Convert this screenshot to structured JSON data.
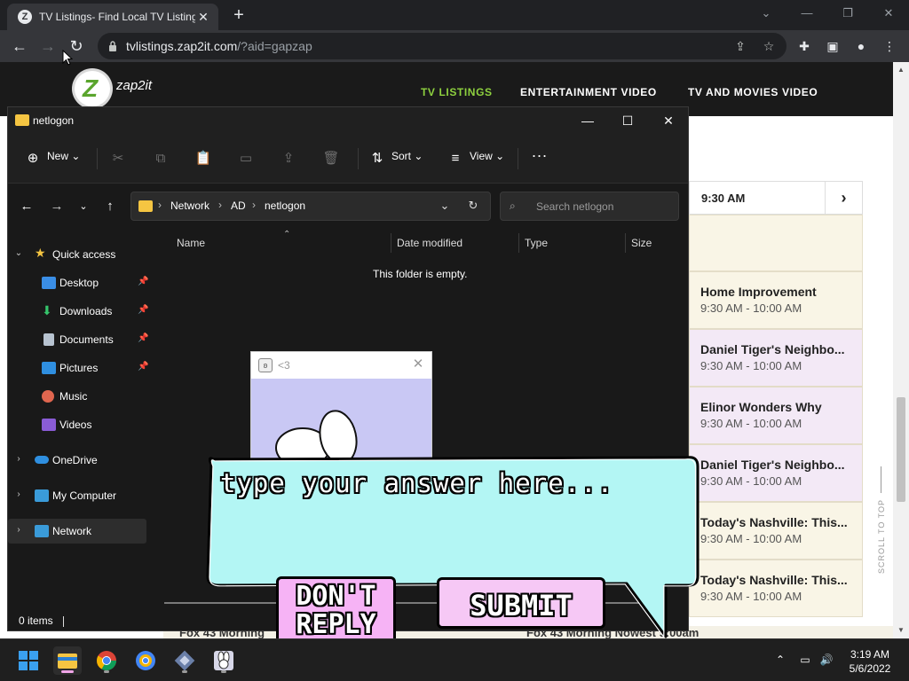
{
  "browser": {
    "tab_title": "TV Listings- Find Local TV Listings",
    "tab_favicon_letter": "Z",
    "url_host": "tvlistings.zap2it.com",
    "url_path": "/?aid=gapzap"
  },
  "site": {
    "logo_word": "zap2it",
    "logo_letter": "Z",
    "nav": [
      "TV LISTINGS",
      "ENTERTAINMENT VIDEO",
      "TV AND MOVIES VIDEO"
    ],
    "time_slot": "9:30 AM",
    "shows": [
      {
        "title": "Home Improvement",
        "time": "9:30 AM - 10:00 AM",
        "bg": "#f9f5e6"
      },
      {
        "title": "Daniel Tiger's Neighbo...",
        "time": "9:30 AM - 10:00 AM",
        "bg": "#f3e9f6"
      },
      {
        "title": "Elinor Wonders Why",
        "time": "9:30 AM - 10:00 AM",
        "bg": "#f3e9f6"
      },
      {
        "title": "Daniel Tiger's Neighbo...",
        "time": "9:30 AM - 10:00 AM",
        "bg": "#f3e9f6"
      },
      {
        "title": "Today's Nashville: This...",
        "time": "9:30 AM - 10:00 AM",
        "bg": "#f9f5e6"
      },
      {
        "title": "Today's Nashville: This...",
        "time": "9:30 AM - 10:00 AM",
        "bg": "#f9f5e6"
      }
    ],
    "scroll_to_top": "SCROLL TO TOP",
    "bottom_left": "Fox 43 Morning",
    "bottom_right": "Fox 43 Morning Nowest 9:00am"
  },
  "explorer": {
    "title": "netlogon",
    "commands": {
      "new": "New",
      "sort": "Sort",
      "view": "View",
      "more": "..."
    },
    "breadcrumb": [
      "Network",
      "AD",
      "netlogon"
    ],
    "search_placeholder": "Search netlogon",
    "nav": {
      "quick_access": "Quick access",
      "items": [
        "Desktop",
        "Downloads",
        "Documents",
        "Pictures",
        "Music",
        "Videos"
      ],
      "onedrive": "OneDrive",
      "my_computer": "My Computer",
      "network": "Network"
    },
    "columns": [
      "Name",
      "Date modified",
      "Type",
      "Size"
    ],
    "empty_message": "This folder is empty.",
    "status": "0 items"
  },
  "popup": {
    "title": "<3",
    "prompt": "type your answer here...",
    "dont_reply": "DON'T\nREPLY",
    "submit": "SUBMIT"
  },
  "taskbar": {
    "time": "3:19 AM",
    "date": "5/6/2022"
  },
  "colors": {
    "bubble": "#b3f6f4",
    "dont_reply": "#f6b3f5",
    "submit": "#f6c8f5",
    "active_nav": "#8ed13f"
  }
}
